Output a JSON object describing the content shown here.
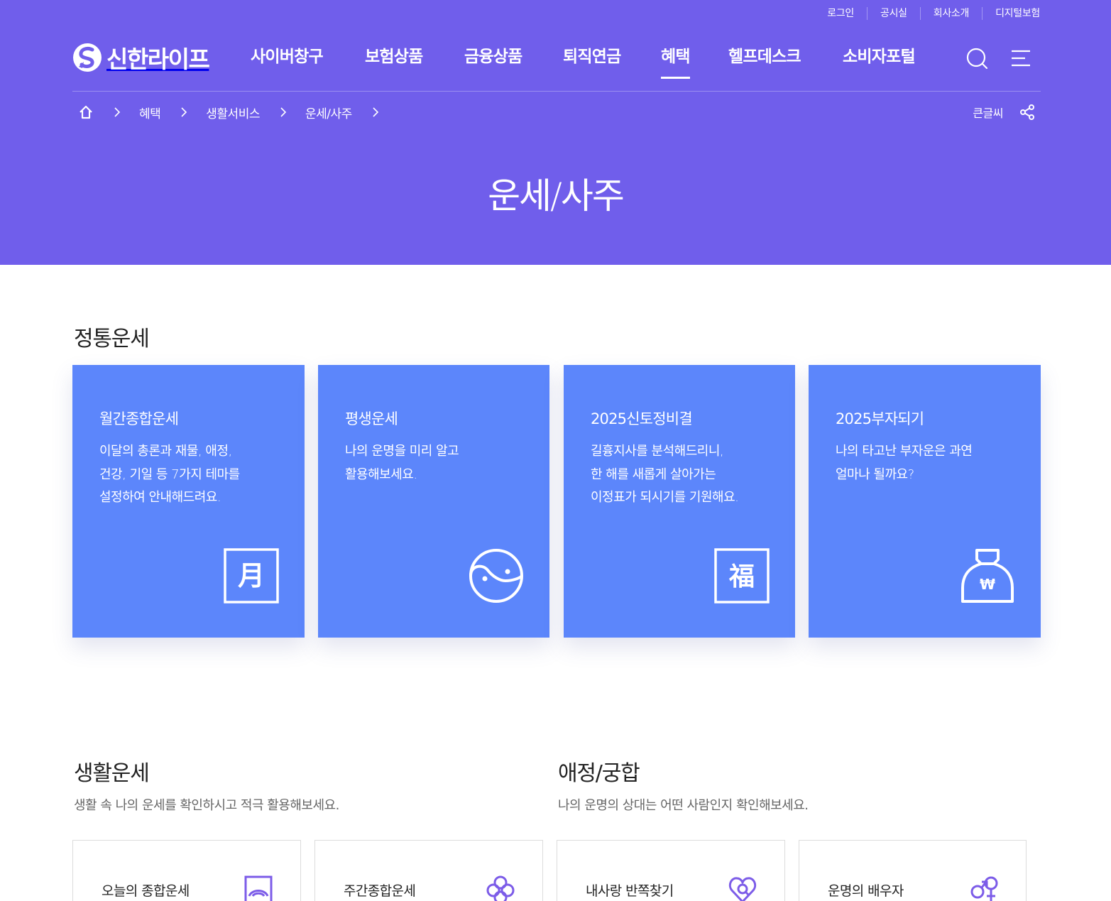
{
  "header": {
    "util_links": [
      "로그인",
      "공시실",
      "회사소개",
      "디지털보험"
    ],
    "logo_text": "신한라이프",
    "nav": [
      "사이버창구",
      "보험상품",
      "금융상품",
      "퇴직연금",
      "혜택",
      "헬프데스크",
      "소비자포털"
    ],
    "active_nav": "혜택",
    "breadcrumb": [
      "혜택",
      "생활서비스",
      "운세/사주"
    ],
    "large_font_label": "큰글씨",
    "page_title": "운세/사주"
  },
  "traditional": {
    "title": "정통운세",
    "cards": [
      {
        "title": "월간종합운세",
        "lines": [
          "이달의 총론과 재물, 애정,",
          "건강, 기일 등 7가지 테마를",
          "설정하여 안내해드려요."
        ],
        "icon": "moon-character-icon",
        "glyph": "月"
      },
      {
        "title": "평생운세",
        "lines": [
          "나의 운명을 미리 알고",
          "활용해보세요."
        ],
        "icon": "yin-yang-icon"
      },
      {
        "title": "2025신토정비결",
        "lines": [
          "길흉지사를 분석해드리니,",
          "한 해를 새롭게 살아가는",
          "이정표가 되시기를 기원해요."
        ],
        "icon": "fortune-character-icon",
        "glyph": "福"
      },
      {
        "title": "2025부자되기",
        "lines": [
          "나의 타고난 부자운은 과연",
          "얼마나 될까요?"
        ],
        "icon": "money-bag-icon",
        "glyph": "₩"
      }
    ]
  },
  "life": {
    "title": "생활운세",
    "subtitle": "생활 속 나의 운세를 확인하시고 적극 활용해보세요.",
    "items": [
      {
        "label": "오늘의 종합운세",
        "icon": "sunrise-icon"
      },
      {
        "label": "주간종합운세",
        "icon": "clover-icon"
      }
    ]
  },
  "love": {
    "title": "애정/궁합",
    "subtitle": "나의 운명의 상대는 어떤 사람인지 확인해보세요.",
    "items": [
      {
        "label": "내사랑 반쪽찾기",
        "icon": "heart-search-icon"
      },
      {
        "label": "운명의 배우자",
        "icon": "gender-symbols-icon"
      }
    ]
  },
  "colors": {
    "hero": "#705eeb",
    "card": "#5c86fb",
    "accent_icon": "#7c5ce8"
  }
}
